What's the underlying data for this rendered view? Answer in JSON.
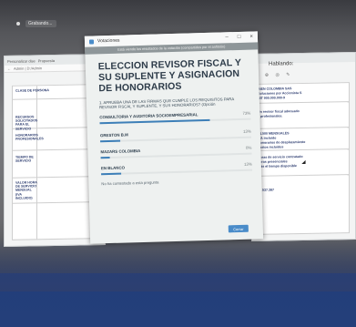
{
  "status": {
    "text": "Grabando..."
  },
  "browser_left": {
    "tab1": "Personalizar dise",
    "tab2": "Propuesta",
    "address": "Admin | D:/Admin"
  },
  "browser_right": {
    "talk_label": "Hablando:"
  },
  "doc_left": {
    "cells": [
      "CLASE DE PERSONA",
      "RECURSOS SOLICITADOS PARA EL SERVICIO",
      "HONORARIOS PROFESIONALES",
      "TIEMPO DE SERVICIO",
      "VALOR HORA DE SERVICIO MENSUAL (IVA INCLUIDO)"
    ]
  },
  "doc_right": {
    "cells": [
      "BIEN COLOMBIA SAS",
      "Soluciones por Accionista S",
      "NIT 900.000.000-9",
      "Un revisor fiscal adecuado",
      "y profesionales.",
      "$4.500 MENSUALES",
      "IVA incluido",
      "Honorarios de desplazamiento",
      "gastos incluidos",
      "Horas de servicio contratado",
      "horas presenciales",
      "más el tiempo disponible",
      "$4.537.387"
    ]
  },
  "dialog": {
    "window_title": "Votaciones",
    "banner": "Está viendo los resultados de la votación (compartidos por el anfitrión)",
    "heading": "ELECCION REVISOR FISCAL Y SU SUPLENTE Y ASIGNACION DE HONORARIOS",
    "question": "1. APRUEBA UNA DE LAS FIRMAS QUE CUMPLE LOS REQUISITOS PARA REVISOR FISCAL Y SUPLENTE, Y SUS HONORARIOS? (Opción",
    "options": [
      {
        "label": "CONSULTORIA Y AUDITORIA SOCIOEMPRESARIAL",
        "percent": "73%",
        "share": 0.73
      },
      {
        "label": "GRESTON B.M",
        "percent": "13%",
        "share": 0.13
      },
      {
        "label": "MAZARS COLOMBIA",
        "percent": "0%",
        "share": 0.0
      },
      {
        "label": "EN BLANCO",
        "percent": "13%",
        "share": 0.13
      }
    ],
    "not_answered": "No ha contestado a esta pregunta",
    "close_label": "Cerrar"
  },
  "colors": {
    "accent": "#3d7fb8",
    "heading": "#2e3c4a",
    "banner": "#8e9699"
  }
}
